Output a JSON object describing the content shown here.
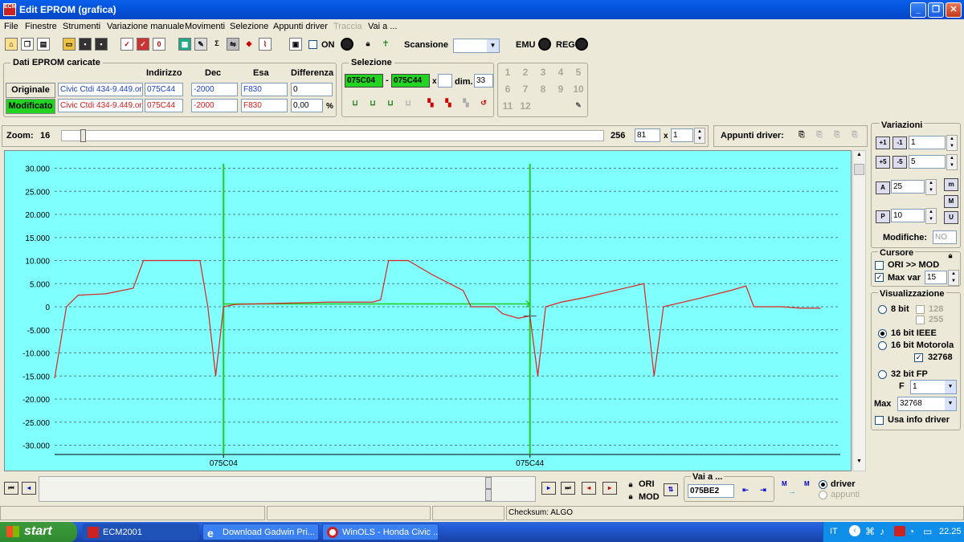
{
  "window": {
    "title": "Edit EPROM (grafica)",
    "icon_text": "ECM"
  },
  "menu": [
    "File",
    "Finestre",
    "Strumenti",
    "Variazione manuale",
    "Movimenti",
    "Selezione",
    "Appunti driver",
    "Traccia",
    "Vai a ..."
  ],
  "menu_disabled": [
    "Traccia"
  ],
  "toolbar": {
    "on_label": "ON",
    "scansione_label": "Scansione",
    "emu_label": "EMU",
    "reg_label": "REG"
  },
  "dati": {
    "group_title": "Dati EPROM caricate",
    "headers": {
      "indirizzo": "Indirizzo",
      "dec": "Dec",
      "esa": "Esa",
      "differenza": "Differenza"
    },
    "originale": {
      "label": "Originale",
      "file": "Civic Ctdi 434-9.449.or",
      "indirizzo": "075C44",
      "dec": "-2000",
      "esa": "F830",
      "diff": "0"
    },
    "modificato": {
      "label": "Modificato",
      "file": "Civic Ctdi 434-9.449.or",
      "indirizzo": "075C44",
      "dec": "-2000",
      "esa": "F830",
      "diff": "0,00",
      "unit": "%"
    }
  },
  "selezione": {
    "group_title": "Selezione",
    "start": "075C04",
    "dash": "-",
    "end": "075C44",
    "x": "x",
    "dim_label": "dim.",
    "dim": "33"
  },
  "numpad": [
    "1",
    "2",
    "3",
    "4",
    "5",
    "6",
    "7",
    "8",
    "9",
    "10",
    "11",
    "12"
  ],
  "zoom": {
    "label": "Zoom:",
    "value": "16",
    "max": "256",
    "field": "81",
    "x": "x",
    "mult": "1",
    "slider_fraction": 0.035
  },
  "appunti": {
    "label": "Appunti driver:"
  },
  "variazioni": {
    "title": "Variazioni",
    "v1": "1",
    "v2": "5",
    "v3": "25",
    "v4": "10",
    "btn_m": "m",
    "btn_M": "M",
    "btn_U": "U",
    "modifiche_label": "Modifiche:",
    "modifiche": "NO"
  },
  "cursore": {
    "title": "Cursore",
    "ori_mod": "ORI >> MOD",
    "ori_mod_checked": false,
    "max_var": "Max var",
    "max_var_checked": true,
    "max_var_value": "15"
  },
  "visualizzazione": {
    "title": "Visualizzazione",
    "bit8": "8 bit",
    "b128": "128",
    "b255": "255",
    "bit16ieee": "16 bit IEEE",
    "bit16moto": "16 bit Motorola",
    "b32768": "32768",
    "bit32fp": "32 bit FP",
    "f_label": "F",
    "f_value": "1",
    "max_label": "Max",
    "max_value": "32768",
    "usa_info": "Usa info driver"
  },
  "bottom": {
    "ori": "ORI",
    "mod": "MOD",
    "vai_a": "Vai a ...",
    "addr": "075BE2",
    "driver": "driver",
    "appunti": "appunti",
    "m1": "M",
    "m2": "M"
  },
  "status": {
    "checksum": "Checksum: ALGO"
  },
  "taskbar": {
    "start": "start",
    "tasks": [
      "ECM2001",
      "Download Gadwin Pri...",
      "WinOLS - Honda Civic ..."
    ],
    "lang": "IT",
    "clock": "22.25"
  },
  "colors": {
    "chart_bg": "#80FFFF",
    "series": "#DD2222",
    "cursor": "#22CC22",
    "field_blue": "#1a3fd1",
    "field_red": "#d21a1a"
  },
  "chart_data": {
    "type": "line",
    "ylim": [
      -32000,
      32000
    ],
    "yticks": [
      "30.000",
      "25.000",
      "20.000",
      "15.000",
      "10.000",
      "5.000",
      "0",
      "-5.000",
      "-10.000",
      "-15.000",
      "-20.000",
      "-25.000",
      "-30.000"
    ],
    "ytick_values": [
      30000,
      25000,
      20000,
      15000,
      10000,
      5000,
      0,
      -5000,
      -10000,
      -15000,
      -20000,
      -25000,
      -30000
    ],
    "xlabels": [
      "075C04",
      "075C44"
    ],
    "xlim": [
      0,
      100
    ],
    "cursor_x": [
      21.5,
      60.5
    ],
    "grid": true,
    "series": [
      {
        "values": [
          [
            0,
            -15500
          ],
          [
            1.5,
            0
          ],
          [
            3,
            2500
          ],
          [
            6.5,
            2800
          ],
          [
            10,
            4000
          ],
          [
            11.3,
            10000
          ],
          [
            18.5,
            10000
          ],
          [
            19.5,
            0
          ],
          [
            20.5,
            -15000
          ],
          [
            21.5,
            0
          ],
          [
            23,
            500
          ],
          [
            30,
            800
          ],
          [
            35,
            1000
          ],
          [
            40.5,
            1000
          ],
          [
            41.5,
            1500
          ],
          [
            42.5,
            10000
          ],
          [
            45,
            10000
          ],
          [
            48,
            7000
          ],
          [
            52,
            3500
          ],
          [
            53,
            0
          ],
          [
            56,
            0
          ],
          [
            57,
            -1500
          ],
          [
            59,
            -2500
          ],
          [
            60.5,
            -2000
          ],
          [
            61.5,
            -15000
          ],
          [
            62.5,
            0
          ],
          [
            64.5,
            1000
          ],
          [
            67.5,
            2000
          ],
          [
            72,
            3800
          ],
          [
            75,
            5000
          ],
          [
            76.3,
            -15000
          ],
          [
            77.5,
            0
          ],
          [
            82,
            1800
          ],
          [
            86,
            3500
          ],
          [
            88,
            4500
          ],
          [
            89,
            0
          ],
          [
            92.5,
            0
          ],
          [
            95,
            -300
          ],
          [
            97.5,
            -300
          ]
        ]
      },
      {
        "values": [
          [
            21.5,
            600
          ],
          [
            60.5,
            600
          ]
        ]
      }
    ]
  }
}
